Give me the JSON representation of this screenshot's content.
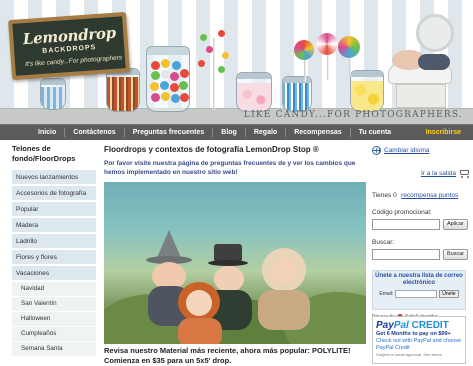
{
  "banner": {
    "sign_title": "Lemondrop",
    "sign_subtitle": "BACKDROPS",
    "sign_tagline": "It's like candy...For photographers",
    "tagline": "LIKE CANDY...FOR PHOTOGRAPHERS."
  },
  "nav": {
    "items": [
      "Inicio",
      "Contáctenos",
      "Preguntas frecuentes",
      "Blog",
      "Regalo",
      "Recompensas",
      "Tu cuenta"
    ],
    "signup": "Inscribirse"
  },
  "sidebar": {
    "title": "Telones de fondo/FloorDrops",
    "items": [
      "Nuevos lanzamientos",
      "Accesorios de fotografía",
      "Popular",
      "Madera",
      "Ladrillo",
      "Flores y flores",
      "Vacaciones"
    ],
    "subitems": [
      "Navidad",
      "San Valentín",
      "Halloween",
      "Cumpleaños",
      "Semana Santa"
    ]
  },
  "main": {
    "title": "Floordrops y contextos de fotografía LemonDrop Stop ®",
    "intro": "Por favor visite nuestra página de preguntas frecuentes de y ver los cambios que hemos implementado en nuestro sitio web!",
    "caption": "Revisa nuestro Material más reciente, ahora más popular: POLYLITE! Comienza en $35 para un 5x5' drop."
  },
  "right": {
    "language_link": "Cambiar idioma",
    "cart_link": "Ir a la salida",
    "points_prefix": "Tienes 0",
    "points_link": "recompensa puntos",
    "promo_label": "Código promocional:",
    "apply_label": "Aplicar",
    "search_label": "Buscar:",
    "search_button": "Buscar",
    "newsletter_title": "Únete a nuestra lista de correo electrónico",
    "email_label": "Email:",
    "join_label": "Únete",
    "powered_prefix": "Privacy by",
    "powered_brand": "SafeSubscribe",
    "paypal": {
      "logo_pay": "Pay",
      "logo_pal": "Pal",
      "logo_credit": "CREDIT",
      "line1": "Get 6 Months to pay on $99+",
      "line2": "Check out with PayPal and choose PayPal Credit",
      "line3": "Subject to credit approval. See terms."
    }
  },
  "colors": {
    "navbar": "#5b5b5b",
    "signup": "#ffd21a",
    "sidebar_item": "#dde7ee",
    "link": "#2850a0"
  }
}
